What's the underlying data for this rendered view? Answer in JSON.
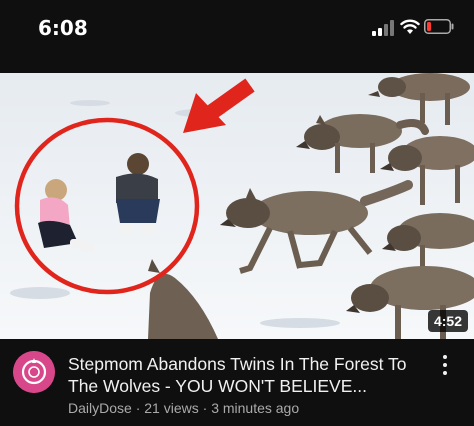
{
  "status_bar": {
    "time": "6:08"
  },
  "video": {
    "duration": "4:52",
    "title": "Stepmom Abandons Twins In The Forest To The Wolves - YOU WON'T BELIEVE...",
    "channel": "DailyDose",
    "separator_1": "·",
    "views": "21 views",
    "separator_2": "·",
    "age": "3 minutes ago"
  },
  "colors": {
    "background": "#0f0f0f",
    "annotation_red": "#e0251c",
    "avatar_pink": "#d8478a",
    "battery_red": "#ff3b30"
  },
  "icons": [
    "signal-icon",
    "wifi-icon",
    "battery-icon",
    "more-vert-icon",
    "channel-avatar-icon",
    "red-arrow-icon"
  ]
}
